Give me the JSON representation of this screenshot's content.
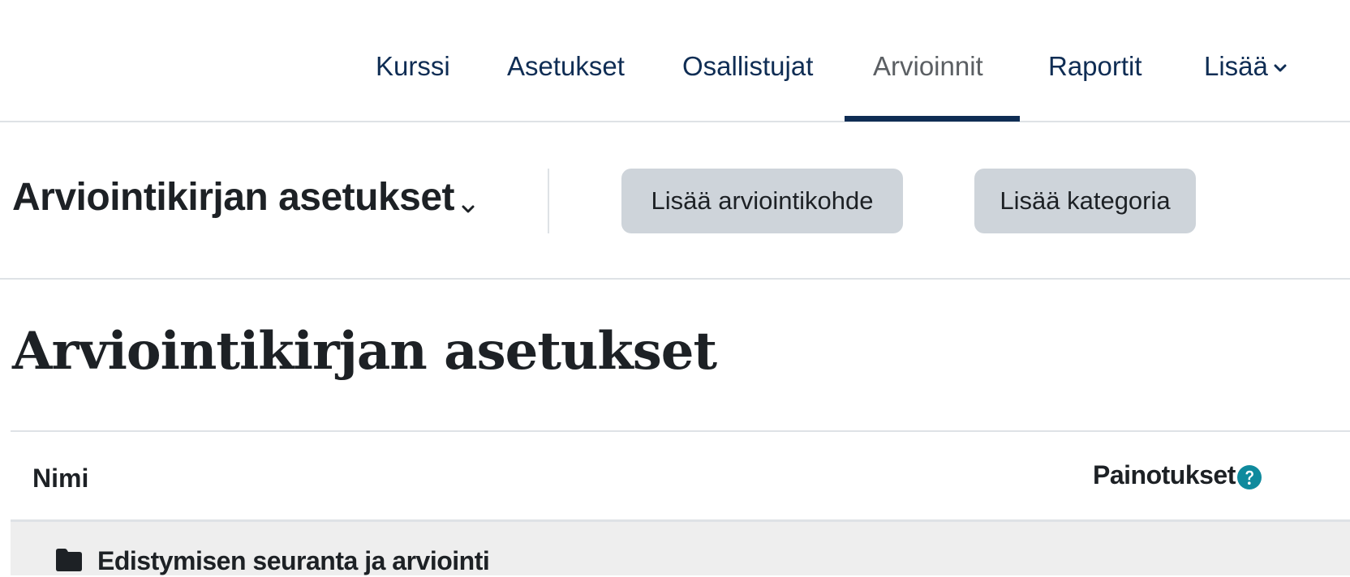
{
  "nav": {
    "items": [
      {
        "label": "Kurssi"
      },
      {
        "label": "Asetukset"
      },
      {
        "label": "Osallistujat"
      },
      {
        "label": "Arvioinnit",
        "active": true
      },
      {
        "label": "Raportit"
      },
      {
        "label": "Lisää",
        "has_dropdown": true
      }
    ]
  },
  "actionbar": {
    "selector_label": "Arviointikirjan asetukset",
    "add_item_label": "Lisää arviointikohde",
    "add_category_label": "Lisää kategoria"
  },
  "page": {
    "heading": "Arviointikirjan asetukset"
  },
  "table": {
    "columns": {
      "name": "Nimi",
      "weights": "Painotukset"
    },
    "rows": [
      {
        "type": "category",
        "icon": "folder-icon",
        "name": "Edistymisen seuranta ja arviointi"
      }
    ]
  },
  "colors": {
    "nav_link": "#0f2d54",
    "nav_active": "#5b5f63",
    "button_bg": "#ced4da",
    "help_icon": "#0f8a9d",
    "category_row_bg": "#eeeeee"
  }
}
